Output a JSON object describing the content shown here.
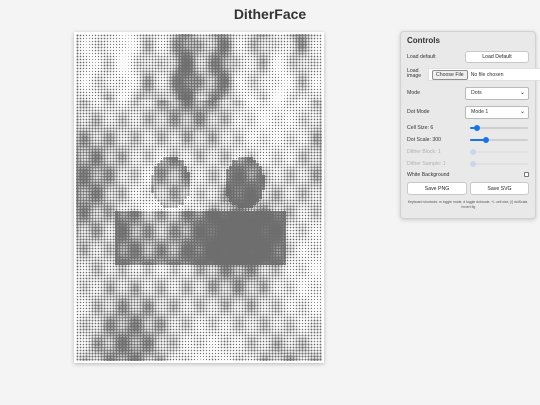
{
  "app": {
    "title": "DitherFace"
  },
  "canvas": {
    "description_icon": "dithered-image"
  },
  "controls": {
    "heading": "Controls",
    "load_default_label": "Load default",
    "load_default_button": "Load Default",
    "load_image_label": "Load image",
    "choose_file_button": "Choose File",
    "no_file_text": "No file chosen",
    "mode_label": "Mode",
    "mode_value": "Dots",
    "dot_mode_label": "Dot Mode",
    "dot_mode_value": "Mode 1",
    "cell_size_label": "Cell Size: 6",
    "cell_size_fraction": 0.12,
    "dot_scale_label": "Dot Scale: 300",
    "dot_scale_fraction": 0.28,
    "dither_block_label": "Dither Block: 1",
    "dither_block_fraction": 0.0,
    "dither_sample_label": "Dither Sample: 1",
    "dither_sample_fraction": 0.0,
    "white_background_label": "White Background",
    "white_background_checked": false,
    "save_png_button": "Save PNG",
    "save_svg_button": "Save SVG",
    "shortcuts_text": "Keyboard shortcuts: m toggle mode, d toggle dotmode, +/- cell size, [/] dotScale, i invert fig"
  },
  "colors": {
    "accent": "#1a73e8",
    "dot": "#6e6e6e",
    "panel_bg": "#e9e9e9"
  }
}
